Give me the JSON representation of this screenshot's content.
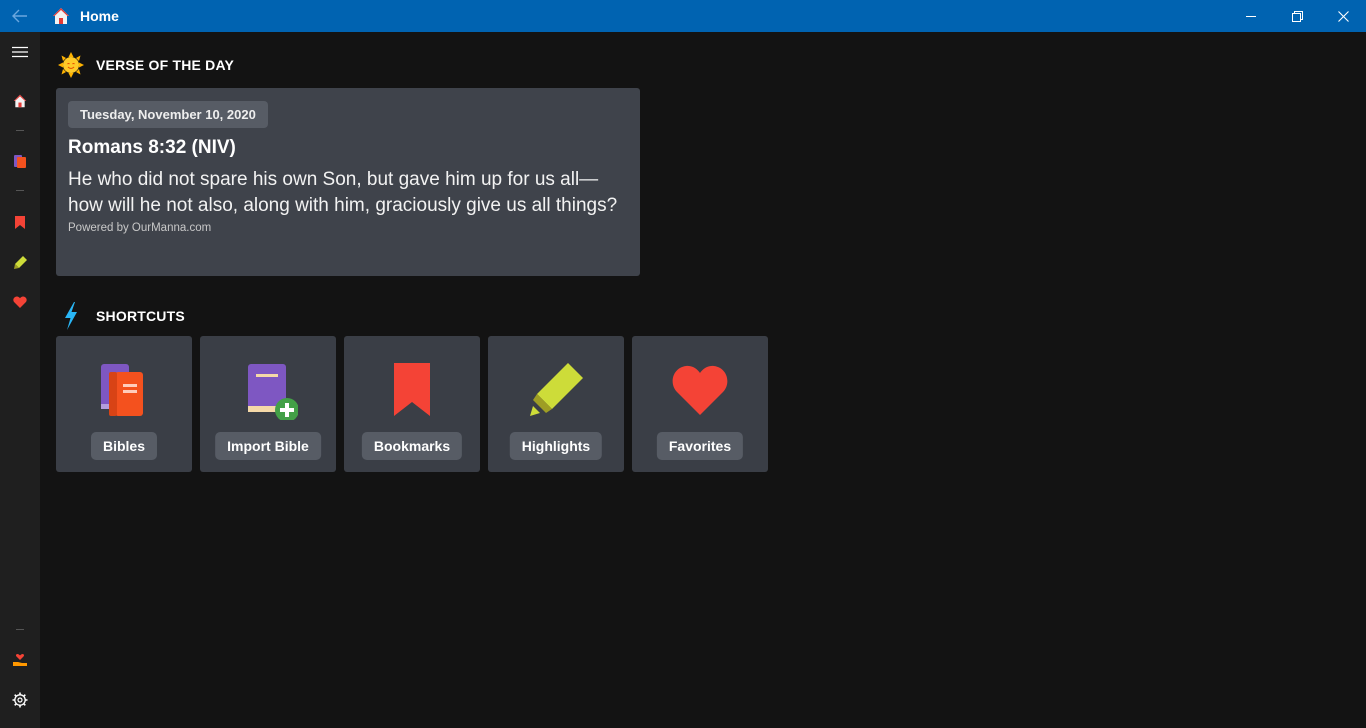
{
  "window": {
    "title": "Home"
  },
  "verse_of_the_day": {
    "heading": "VERSE OF THE DAY",
    "date": "Tuesday, November 10, 2020",
    "reference": "Romans 8:32 (NIV)",
    "text": "He who did not spare his own Son, but gave him up for us all—how will he not also, along with him, graciously give us all things?",
    "powered_by": "Powered by OurManna.com"
  },
  "shortcuts": {
    "heading": "SHORTCUTS",
    "items": [
      {
        "label": "Bibles",
        "icon": "books-icon"
      },
      {
        "label": "Import Bible",
        "icon": "import-bible-icon"
      },
      {
        "label": "Bookmarks",
        "icon": "bookmark-icon"
      },
      {
        "label": "Highlights",
        "icon": "highlighter-icon"
      },
      {
        "label": "Favorites",
        "icon": "heart-icon"
      }
    ]
  },
  "colors": {
    "titlebar": "#0063b1",
    "sidebar": "#1f1f1f",
    "background": "#131313",
    "card": "#3f434b",
    "tile": "#3a3e46",
    "pill": "#575c65"
  }
}
